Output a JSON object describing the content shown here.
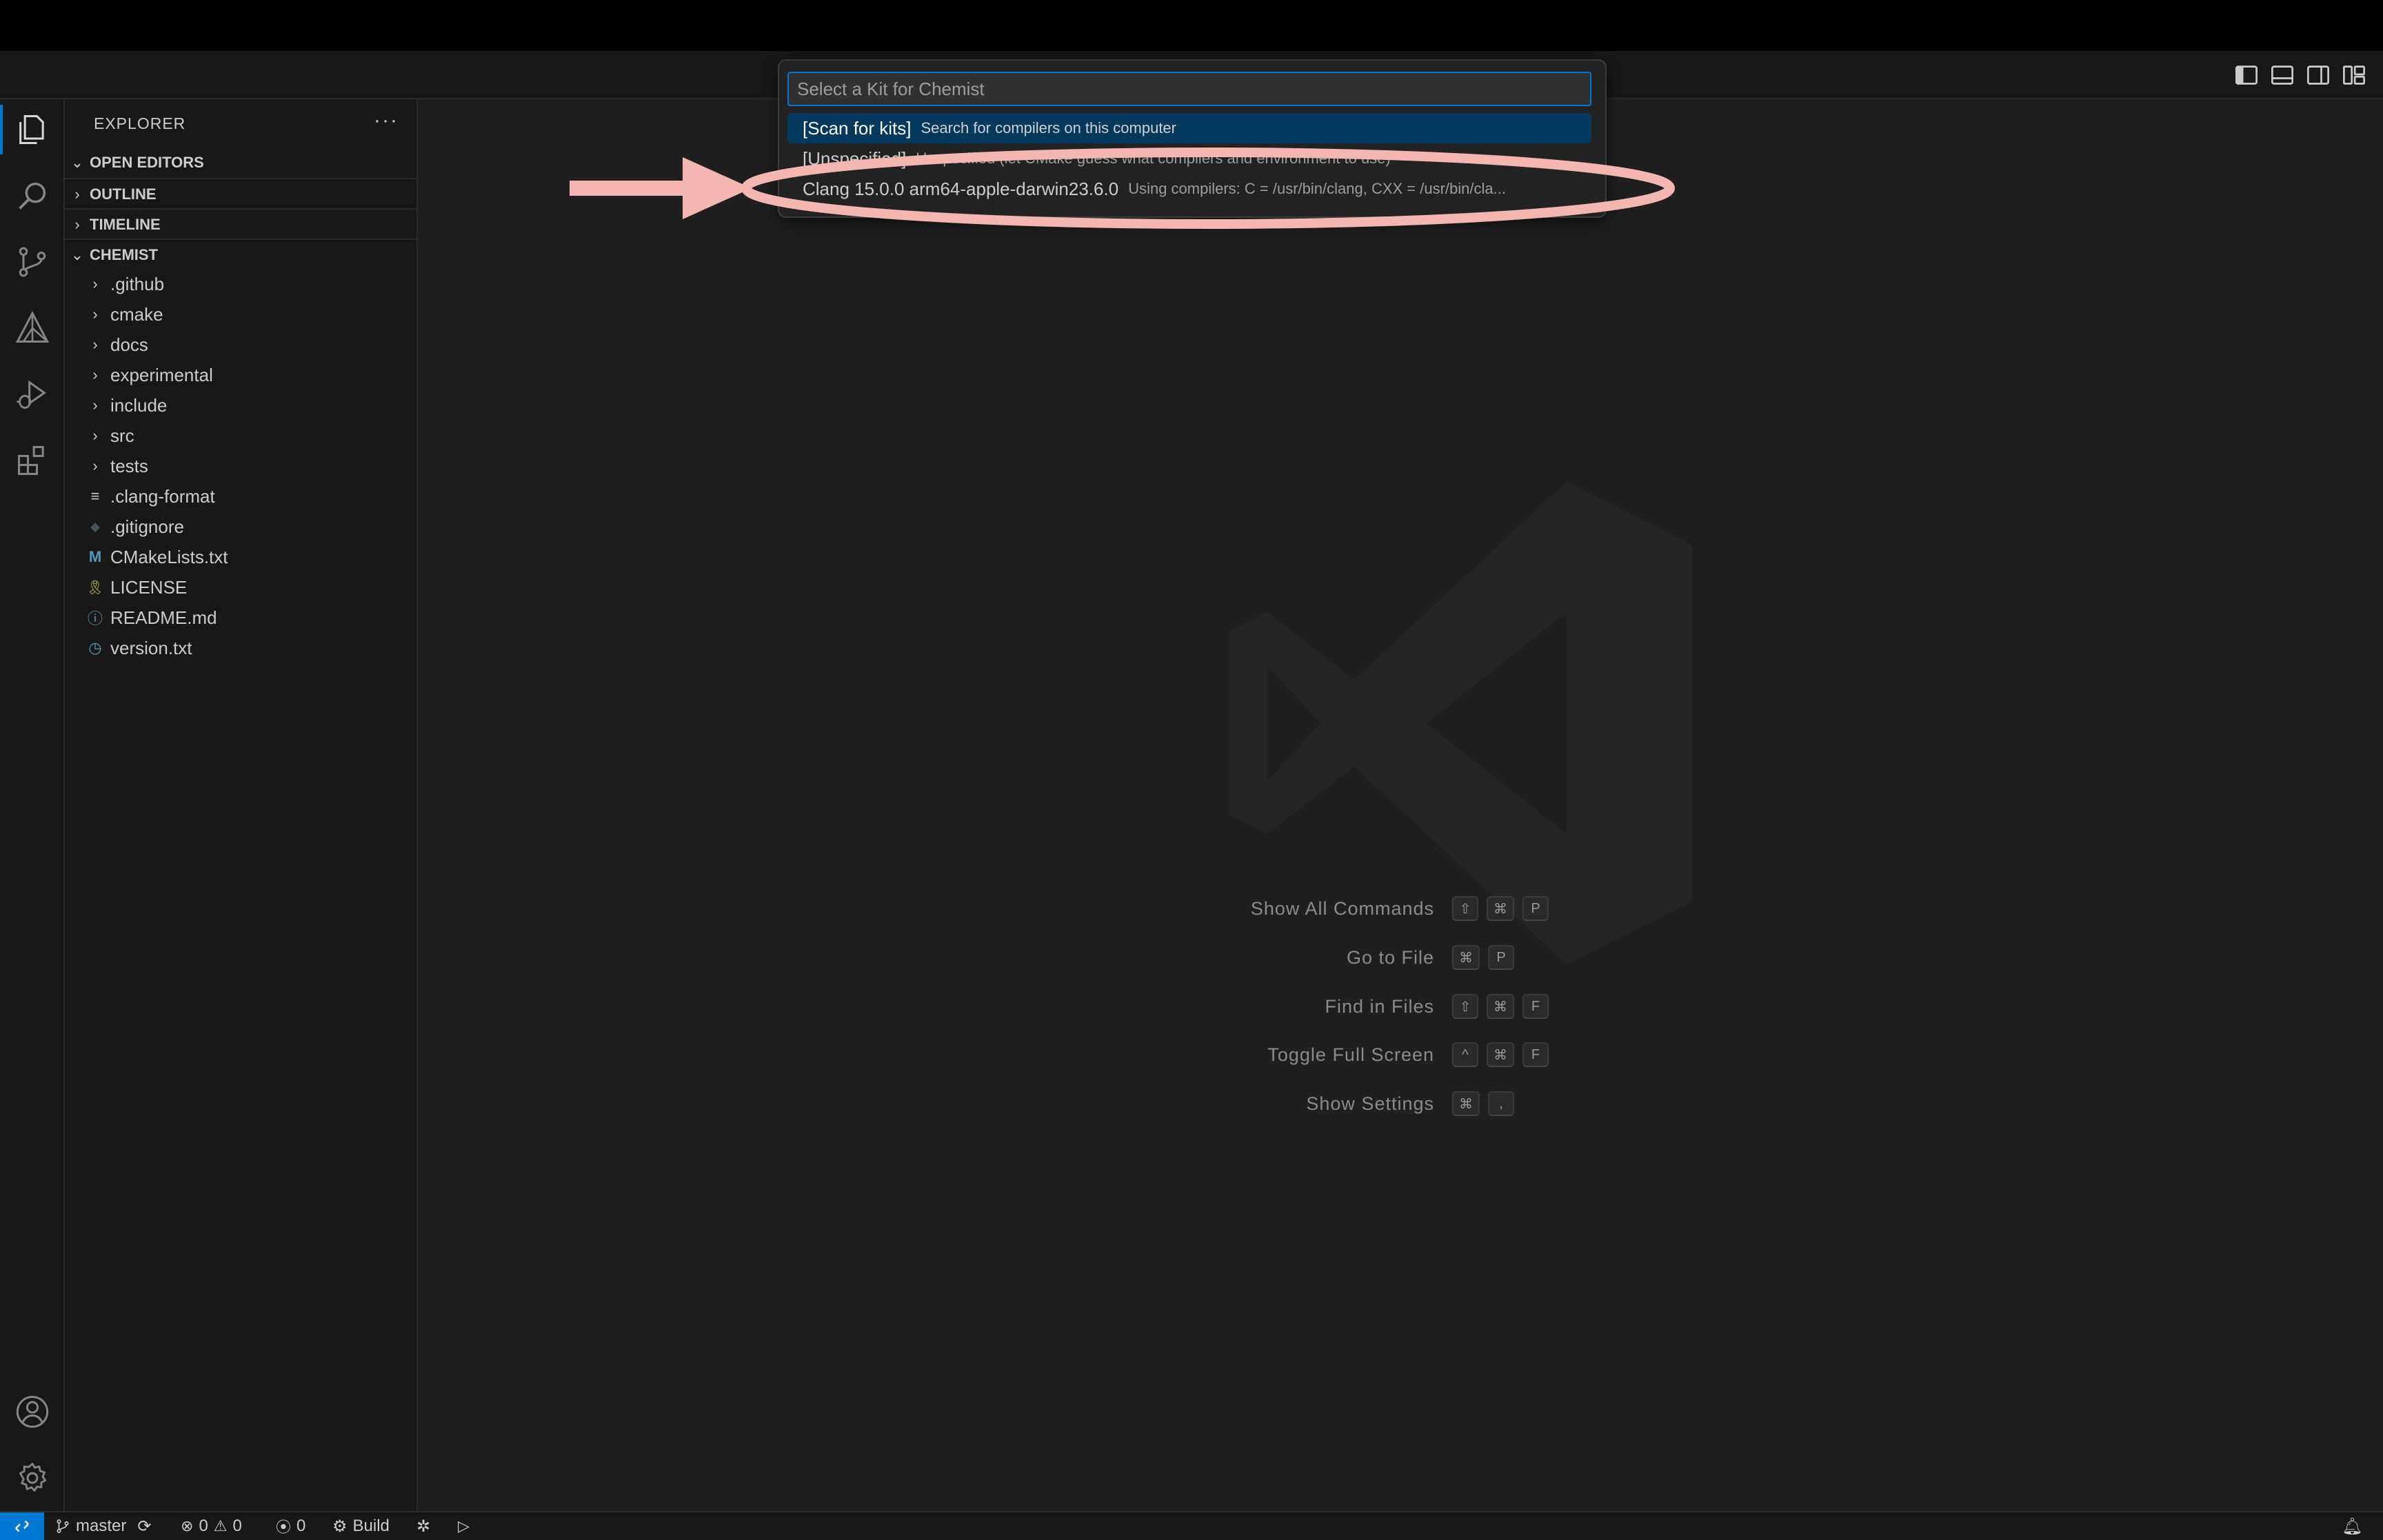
{
  "sidebar": {
    "title": "EXPLORER",
    "more": "···",
    "sections": {
      "open_editors": "OPEN EDITORS",
      "outline": "OUTLINE",
      "timeline": "TIMELINE",
      "project": "CHEMIST"
    },
    "folders": [
      ".github",
      "cmake",
      "docs",
      "experimental",
      "include",
      "src",
      "tests"
    ],
    "files": [
      {
        "name": ".clang-format",
        "icon": "lines-icon"
      },
      {
        "name": ".gitignore",
        "icon": "git-diamond-icon"
      },
      {
        "name": "CMakeLists.txt",
        "icon": "m-icon"
      },
      {
        "name": "LICENSE",
        "icon": "license-icon"
      },
      {
        "name": "README.md",
        "icon": "info-icon"
      },
      {
        "name": "version.txt",
        "icon": "clock-icon"
      }
    ],
    "file_glyphs": [
      "≡",
      "◆",
      "M",
      "🎗",
      "ⓘ",
      "◷"
    ]
  },
  "quickpick": {
    "placeholder": "Select a Kit for Chemist",
    "items": [
      {
        "label": "[Scan for kits]",
        "description": "Search for compilers on this computer"
      },
      {
        "label": "[Unspecified]",
        "description": "Unspecified (let CMake guess what compilers and environment to use)"
      },
      {
        "label": "Clang 15.0.0 arm64-apple-darwin23.6.0",
        "description": "Using compilers: C = /usr/bin/clang, CXX = /usr/bin/cla..."
      }
    ]
  },
  "watermark": {
    "commands": [
      {
        "label": "Show All Commands",
        "keys": [
          "⇧",
          "⌘",
          "P"
        ]
      },
      {
        "label": "Go to File",
        "keys": [
          "⌘",
          "P"
        ]
      },
      {
        "label": "Find in Files",
        "keys": [
          "⇧",
          "⌘",
          "F"
        ]
      },
      {
        "label": "Toggle Full Screen",
        "keys": [
          "^",
          "⌘",
          "F"
        ]
      },
      {
        "label": "Show Settings",
        "keys": [
          "⌘",
          ","
        ]
      }
    ]
  },
  "statusbar": {
    "branch": "master",
    "errors": "0",
    "warnings": "0",
    "ports": "0",
    "build": "Build"
  },
  "colors": {
    "accent": "#0078d4",
    "selection": "#04395e",
    "annotation": "#f4b6b1"
  }
}
